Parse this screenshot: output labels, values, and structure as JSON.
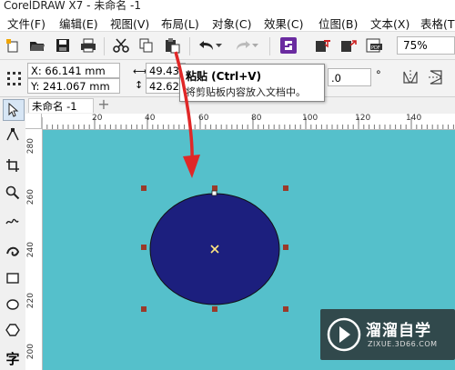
{
  "window": {
    "title": "CorelDRAW X7 - 未命名 -1"
  },
  "menu": [
    {
      "label": "文件(F)"
    },
    {
      "label": "编辑(E)"
    },
    {
      "label": "视图(V)"
    },
    {
      "label": "布局(L)"
    },
    {
      "label": "对象(C)"
    },
    {
      "label": "效果(C)"
    },
    {
      "label": "位图(B)"
    },
    {
      "label": "文本(X)"
    },
    {
      "label": "表格(T"
    }
  ],
  "toolbar": {
    "zoom_value": "75%"
  },
  "propbar": {
    "x_value": "X: 66.141 mm",
    "y_value": "Y: 241.067 mm",
    "width_value": "49.43 m",
    "height_value": "42.623",
    "angle_value": ".0",
    "degree_symbol": "°"
  },
  "tooltip": {
    "title": "粘贴 (Ctrl+V)",
    "description": "将剪贴板内容放入文档中。"
  },
  "document": {
    "tab_label": "未命名 -1",
    "add_tab_label": "+"
  },
  "rulers": {
    "horizontal": [
      "20",
      "40",
      "60",
      "80",
      "100",
      "120",
      "140"
    ],
    "vertical": [
      "280",
      "260",
      "240",
      "220",
      "200"
    ]
  },
  "toolbox": {
    "text_tool_label": "字"
  },
  "canvas": {
    "background_color": "#55c0cb",
    "ellipse_fill": "#1c1f7e",
    "handle_color": "#9a3a2a",
    "arrow_color": "#e02727"
  },
  "watermark": {
    "brand": "溜溜自学",
    "url": "ZIXUE.3D66.COM"
  }
}
